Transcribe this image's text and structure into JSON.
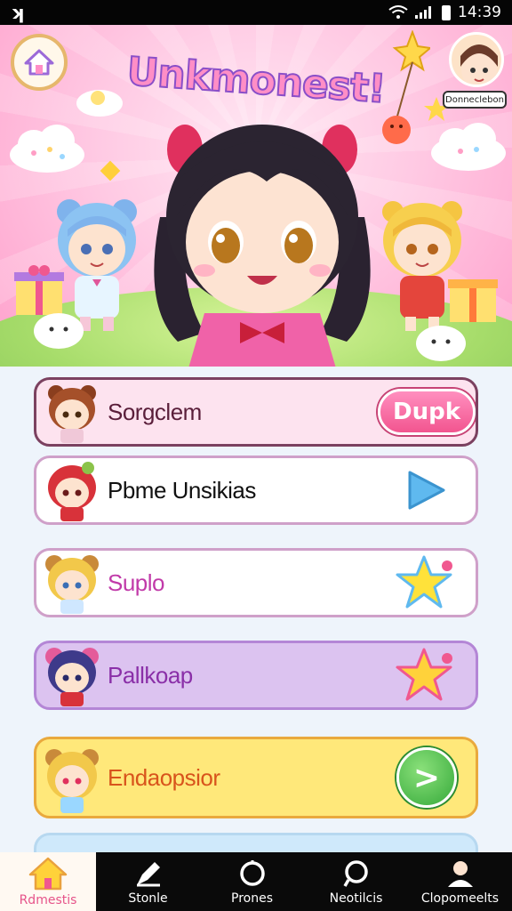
{
  "status_bar": {
    "left_icon": "k-notification-icon",
    "time": "14:39"
  },
  "header": {
    "title": "Unkmonest!",
    "avatar_label": "Donneclebon",
    "home_icon": "home-icon"
  },
  "list": {
    "items": [
      {
        "label": "Sorgclem",
        "action": "Dupk",
        "action_type": "pill-button",
        "color": "#fde3ef",
        "label_color": "#5a1e3a"
      },
      {
        "label": "Pbme Unsikias",
        "action_icon": "play-triangle-icon",
        "color": "#ffffff",
        "label_color": "#111111"
      },
      {
        "label": "Suplo",
        "action_icon": "star-icon",
        "color": "#ffffff",
        "label_color": "#c13aa9"
      },
      {
        "label": "Pallkoap",
        "action_icon": "star-icon",
        "color": "#dcc3f0",
        "label_color": "#8a2fa8"
      },
      {
        "label": "Endaopsior",
        "action_icon": "chevron-right-icon",
        "action": ">",
        "color": "#ffe87a",
        "label_color": "#d8541c"
      }
    ]
  },
  "nav": {
    "items": [
      {
        "label": "Rdmestis",
        "icon": "home-icon",
        "active": true
      },
      {
        "label": "Stonle",
        "icon": "pencil-icon",
        "active": false
      },
      {
        "label": "Prones",
        "icon": "search-icon",
        "active": false
      },
      {
        "label": "Neotilcis",
        "icon": "chat-icon",
        "active": false
      },
      {
        "label": "Clopomeelts",
        "icon": "profile-icon",
        "active": false
      }
    ]
  },
  "colors": {
    "accent_pink": "#f2558f",
    "nav_bg": "#0a0a0a",
    "hero_pink": "#ff9fcb"
  }
}
